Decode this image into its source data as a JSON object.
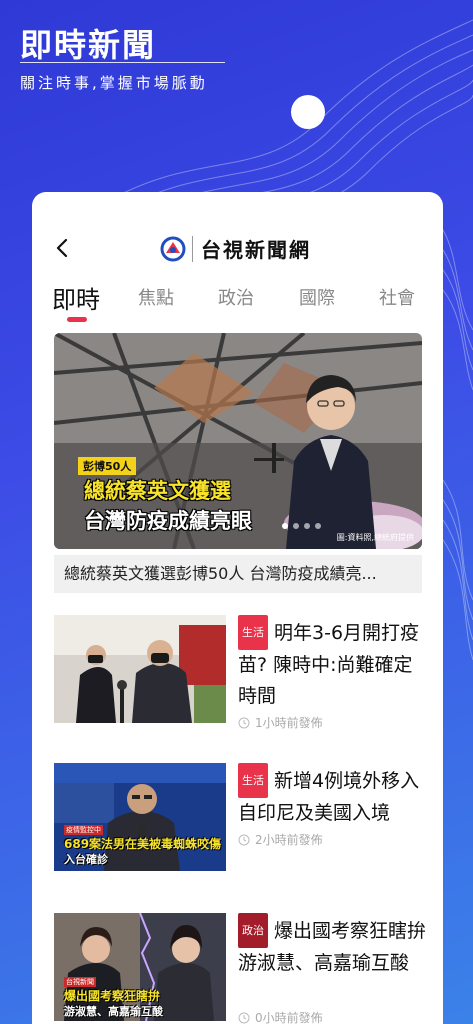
{
  "promo": {
    "title": "即時新聞",
    "subtitle": "關注時事,掌握市場脈動"
  },
  "app": {
    "brand_name": "台視新聞網"
  },
  "tabs": [
    {
      "label": "即時",
      "active": true
    },
    {
      "label": "焦點",
      "active": false
    },
    {
      "label": "政治",
      "active": false
    },
    {
      "label": "國際",
      "active": false
    },
    {
      "label": "社會",
      "active": false
    }
  ],
  "hero": {
    "tag": "彭博50人",
    "headline": "總統蔡英文獲選",
    "subline": "台灣防疫成績亮眼",
    "credit": "圖:資料照,總統府提供",
    "caption": "總統蔡英文獲選彭博50人 台灣防疫成績亮...",
    "dot_count": 4,
    "active_dot": 0
  },
  "news": [
    {
      "category": "生活",
      "category_color": "#e8334a",
      "title": "明年3-6月開打疫苗? 陳時中:尚難確定時間",
      "time": "1小時前發佈"
    },
    {
      "category": "生活",
      "category_color": "#e8334a",
      "title": "新增4例境外移入 自印尼及美國入境",
      "time": "2小時前發佈",
      "thumb_red": "疫情監控中",
      "thumb_yellow": "689案法男在美被毒蜘蛛咬傷",
      "thumb_white": "入台確診"
    },
    {
      "category": "政治",
      "category_color": "#a31c2a",
      "title": "爆出國考察狂瞎拚 游淑慧、高嘉瑜互酸",
      "time": "0小時前發佈",
      "thumb_red": "台視新聞",
      "thumb_yellow": "爆出國考察狂瞎拚",
      "thumb_white": "游淑慧、高嘉瑜互酸"
    }
  ],
  "colors": {
    "accent": "#e8334a",
    "background_start": "#2f39d6",
    "background_end": "#3b82e8"
  }
}
